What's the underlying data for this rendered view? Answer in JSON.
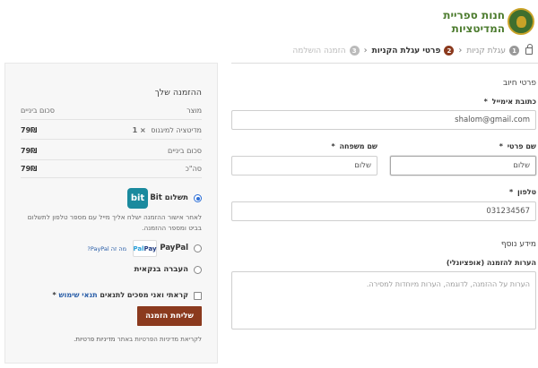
{
  "logo": {
    "line1": "חנות ספריית",
    "line2": "המדיטציות"
  },
  "breadcrumb": {
    "steps": [
      {
        "num": "1",
        "label": "עגלת קניות"
      },
      {
        "num": "2",
        "label": "פרטי עגלת הקניות"
      },
      {
        "num": "3",
        "label": "הזמנה הושלמה"
      }
    ]
  },
  "billing": {
    "title": "פרטי חיוב",
    "email_label": "כתובת אימייל",
    "email_value": "shalom@gmail.com",
    "first_name_label": "שם פרטי",
    "first_name_value": "שלום",
    "last_name_label": "שם משפחה",
    "last_name_value": "שלום",
    "phone_label": "טלפון",
    "phone_value": "031234567",
    "required_mark": "*"
  },
  "extra": {
    "title": "מידע נוסף",
    "notes_label": "הערות להזמנה (אופציונלי)",
    "notes_placeholder": "הערות על ההזמנה, לדוגמה, הערות מיוחדות למסירה."
  },
  "order": {
    "title": "ההזמנה שלך",
    "col_product": "מוצר",
    "col_subtotal": "סכום ביניים",
    "item_name": "מדיטציה למיגנוס",
    "item_qty": "× 1",
    "item_amount": "79₪",
    "subtotal_label": "סכום ביניים",
    "subtotal_amount": "79₪",
    "total_label": "סה\"כ",
    "total_amount": "79₪"
  },
  "payment": {
    "bit_label": "תשלום Bit",
    "bit_logo": "bit",
    "bit_desc": "לאחר אישור ההזמנה ישלח אליך מייל עם מספר טלפון לתשלום בביט ומספר ההזמנה.",
    "paypal_label": "PayPal",
    "paypal_logo_a": "Pay",
    "paypal_logo_b": "Pal",
    "paypal_what": "מה זה PayPal?",
    "bank_label": "העברה בנקאית",
    "terms_text": "קראתי ואני מסכים לתנאים",
    "terms_link": "תנאי שימוש",
    "terms_req": "*",
    "submit_label": "שליחת הזמנה",
    "privacy_text": "לקריאת מדיניות הפרטיות באתר",
    "privacy_link": "מדיניות פרטיות."
  },
  "colors": {
    "accent": "#8b3a1e",
    "brand_green": "#4d7c2f",
    "link": "#2a5ea8"
  }
}
